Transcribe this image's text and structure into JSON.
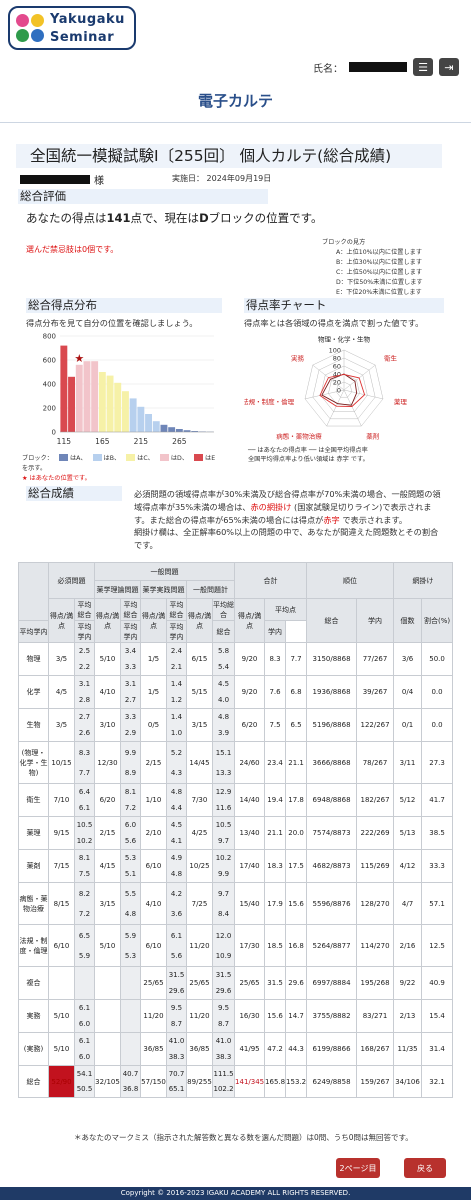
{
  "header": {
    "logo_line1": "Yakugaku",
    "logo_line2": "Seminar",
    "user_label": "氏名：",
    "list_icon": "list-icon",
    "logout_icon": "logout-icon",
    "page_title": "電子カルテ"
  },
  "exam": {
    "title": "全国統一模擬試験Ⅰ〔255回〕 個人カルテ(総合成績)",
    "name_suffix": "様",
    "date": "実施日： 2024年09月19日"
  },
  "evaluation": {
    "heading": "総合評価",
    "line_a": "あなたの得点は",
    "score": "141",
    "line_b": "点で、現在は",
    "block": "D",
    "line_c": "ブロックの位置です。",
    "forbidden": "選んだ禁忌肢は0個です。",
    "block_guide_title": "ブロックの見方",
    "block_guide": [
      "A：上位10%以内に位置します",
      "B：上位30%以内に位置します",
      "C：上位50%以内に位置します",
      "D：下位50%未満に位置します",
      "E：下位20%未満に位置します"
    ]
  },
  "distribution": {
    "heading": "総合得点分布",
    "sub": "得点分布を見て自分の位置を確認しましょう。",
    "legend_prefix": "ブロック：",
    "legend_items": [
      "はA、",
      "はB、",
      "はC、",
      "はD、",
      "はE"
    ],
    "legend_suffix": "を示す。",
    "star_note": "★ はあなたの位置です。"
  },
  "radar": {
    "heading": "得点率チャート",
    "sub": "得点率とは各領域の得点を満点で割った値です。",
    "legend_1": "── はあなたの得点率  ── は全国平均得点率",
    "legend_2": "全国平均得点率より低い領域は 赤字 です。"
  },
  "results": {
    "heading": "総合成績",
    "note_1": "必須問題の領域得点率が30%未満及び総合得点率が70%未満の場合、一般問題の領域得点率が35%未満の場合は、",
    "note_red_1": "赤の網掛け",
    "note_2": " (国家試験足切りライン)で表示されます。また総合の得点率が65%未満の場合には得点が",
    "note_red_2": "赤字",
    "note_3": " で表示されます。",
    "note_4": "網掛け欄は、全正解率60%以上の問題の中で、あなたが間違えた問題数とその割合です。"
  },
  "table": {
    "h_required": "必須問題",
    "h_general": "一般問題",
    "h_theory": "薬学理論問題",
    "h_practice": "薬学実践問題",
    "h_gen_total": "一般問題計",
    "h_total": "合計",
    "h_rank": "順位",
    "h_net": "網掛け",
    "h_score": "得点/満点",
    "h_avg_total": "平均総合",
    "h_avg_school": "平均学内",
    "h_avg": "平均点",
    "h_sogo": "総合",
    "h_gakunai": "学内",
    "h_count": "個数",
    "h_ratio": "割合(%)",
    "rows": [
      {
        "name": "物理",
        "req": "3/5",
        "req_a": "2.5",
        "req_b": "2.2",
        "th": "5/10",
        "th_a": "3.4",
        "th_b": "3.3",
        "pr": "1/5",
        "pr_a": "2.4",
        "pr_b": "2.1",
        "gt": "6/15",
        "gt_a": "5.8",
        "gt_b": "5.4",
        "tot": "9/20",
        "avg_t": "8.3",
        "avg_s": "7.7",
        "rank_t": "3150/8868",
        "rank_s": "77/267",
        "n": "3/6",
        "r": "50.0"
      },
      {
        "name": "化学",
        "req": "4/5",
        "req_a": "3.1",
        "req_b": "2.8",
        "th": "4/10",
        "th_a": "3.1",
        "th_b": "2.7",
        "pr": "1/5",
        "pr_a": "1.4",
        "pr_b": "1.2",
        "gt": "5/15",
        "gt_a": "4.5",
        "gt_b": "4.0",
        "tot": "9/20",
        "avg_t": "7.6",
        "avg_s": "6.8",
        "rank_t": "1936/8868",
        "rank_s": "39/267",
        "n": "0/4",
        "r": "0.0"
      },
      {
        "name": "生物",
        "req": "3/5",
        "req_a": "2.7",
        "req_b": "2.6",
        "th": "3/10",
        "th_a": "3.3",
        "th_b": "2.9",
        "pr": "0/5",
        "pr_a": "1.4",
        "pr_b": "1.0",
        "gt": "3/15",
        "gt_a": "4.8",
        "gt_b": "3.9",
        "tot": "6/20",
        "avg_t": "7.5",
        "avg_s": "6.5",
        "rank_t": "5196/8868",
        "rank_s": "122/267",
        "n": "0/1",
        "r": "0.0"
      },
      {
        "name": "(物理・化学・生物)",
        "req": "10/15",
        "req_a": "8.3",
        "req_b": "7.7",
        "th": "12/30",
        "th_a": "9.9",
        "th_b": "8.9",
        "pr": "2/15",
        "pr_a": "5.2",
        "pr_b": "4.3",
        "gt": "14/45",
        "gt_a": "15.1",
        "gt_b": "13.3",
        "tot": "24/60",
        "avg_t": "23.4",
        "avg_s": "21.1",
        "rank_t": "3666/8868",
        "rank_s": "78/267",
        "n": "3/11",
        "r": "27.3"
      },
      {
        "name": "衛生",
        "req": "7/10",
        "req_a": "6.4",
        "req_b": "6.1",
        "th": "6/20",
        "th_a": "8.1",
        "th_b": "7.2",
        "pr": "1/10",
        "pr_a": "4.8",
        "pr_b": "4.4",
        "gt": "7/30",
        "gt_a": "12.9",
        "gt_b": "11.6",
        "tot": "14/40",
        "avg_t": "19.4",
        "avg_s": "17.8",
        "rank_t": "6948/8868",
        "rank_s": "182/267",
        "n": "5/12",
        "r": "41.7"
      },
      {
        "name": "薬理",
        "req": "9/15",
        "req_a": "10.5",
        "req_b": "10.2",
        "th": "2/15",
        "th_a": "6.0",
        "th_b": "5.6",
        "pr": "2/10",
        "pr_a": "4.5",
        "pr_b": "4.1",
        "gt": "4/25",
        "gt_a": "10.5",
        "gt_b": "9.7",
        "tot": "13/40",
        "avg_t": "21.1",
        "avg_s": "20.0",
        "rank_t": "7574/8873",
        "rank_s": "222/269",
        "n": "5/13",
        "r": "38.5"
      },
      {
        "name": "薬剤",
        "req": "7/15",
        "req_a": "8.1",
        "req_b": "7.5",
        "th": "4/15",
        "th_a": "5.3",
        "th_b": "5.1",
        "pr": "6/10",
        "pr_a": "4.9",
        "pr_b": "4.8",
        "gt": "10/25",
        "gt_a": "10.2",
        "gt_b": "9.9",
        "tot": "17/40",
        "avg_t": "18.3",
        "avg_s": "17.5",
        "rank_t": "4682/8873",
        "rank_s": "115/269",
        "n": "4/12",
        "r": "33.3"
      },
      {
        "name": "病態・薬物治療",
        "req": "8/15",
        "req_a": "8.2",
        "req_b": "7.2",
        "th": "3/15",
        "th_a": "5.5",
        "th_b": "4.8",
        "pr": "4/10",
        "pr_a": "4.2",
        "pr_b": "3.6",
        "gt": "7/25",
        "gt_a": "9.7",
        "gt_b": "8.4",
        "tot": "15/40",
        "avg_t": "17.9",
        "avg_s": "15.6",
        "rank_t": "5596/8876",
        "rank_s": "128/270",
        "n": "4/7",
        "r": "57.1"
      },
      {
        "name": "法規・制度・倫理",
        "req": "6/10",
        "req_a": "6.5",
        "req_b": "5.9",
        "th": "5/10",
        "th_a": "5.9",
        "th_b": "5.3",
        "pr": "6/10",
        "pr_a": "6.1",
        "pr_b": "5.6",
        "gt": "11/20",
        "gt_a": "12.0",
        "gt_b": "10.9",
        "tot": "17/30",
        "avg_t": "18.5",
        "avg_s": "16.8",
        "rank_t": "5264/8877",
        "rank_s": "114/270",
        "n": "2/16",
        "r": "12.5"
      },
      {
        "name": "複合",
        "req": "",
        "req_a": "",
        "req_b": "",
        "th": "",
        "th_a": "",
        "th_b": "",
        "pr": "25/65",
        "pr_a": "31.5",
        "pr_b": "29.6",
        "gt": "25/65",
        "gt_a": "31.5",
        "gt_b": "29.6",
        "tot": "25/65",
        "avg_t": "31.5",
        "avg_s": "29.6",
        "rank_t": "6997/8884",
        "rank_s": "195/268",
        "n": "9/22",
        "r": "40.9"
      },
      {
        "name": "実務",
        "req": "5/10",
        "req_a": "6.1",
        "req_b": "6.0",
        "th": "",
        "th_a": "",
        "th_b": "",
        "pr": "11/20",
        "pr_a": "9.5",
        "pr_b": "8.7",
        "gt": "11/20",
        "gt_a": "9.5",
        "gt_b": "8.7",
        "tot": "16/30",
        "avg_t": "15.6",
        "avg_s": "14.7",
        "rank_t": "3755/8882",
        "rank_s": "83/271",
        "n": "2/13",
        "r": "15.4"
      },
      {
        "name": "(実務)",
        "req": "5/10",
        "req_a": "6.1",
        "req_b": "6.0",
        "th": "",
        "th_a": "",
        "th_b": "",
        "pr": "36/85",
        "pr_a": "41.0",
        "pr_b": "38.3",
        "gt": "36/85",
        "gt_a": "41.0",
        "gt_b": "38.3",
        "tot": "41/95",
        "avg_t": "47.2",
        "avg_s": "44.3",
        "rank_t": "6199/8866",
        "rank_s": "168/267",
        "n": "11/35",
        "r": "31.4"
      },
      {
        "name": "総合",
        "req": "52/90",
        "req_a": "54.1",
        "req_b": "50.5",
        "th": "32/105",
        "th_a": "40.7",
        "th_b": "36.8",
        "pr": "57/150",
        "pr_a": "70.7",
        "pr_b": "65.1",
        "gt": "89/255",
        "gt_a": "111.5",
        "gt_b": "102.2",
        "tot": "141/345",
        "avg_t": "165.8",
        "avg_s": "153.2",
        "rank_t": "6249/8858",
        "rank_s": "159/267",
        "n": "34/106",
        "r": "32.1"
      }
    ]
  },
  "footnote": "＊あなたのマークミス（指示された解答数と異なる数を選んだ問題）は0問、うち0問は無回答です。",
  "buttons": {
    "page2": "2ページ目",
    "back": "戻る"
  },
  "footer": "Copyright © 2016-2023 IGAKU ACADEMY ALL RIGHTS RESERVED.",
  "chart_data": [
    {
      "type": "bar",
      "title": "総合得点分布",
      "x_ticks": [
        115,
        165,
        215,
        265
      ],
      "y_ticks": [
        0,
        200,
        400,
        600,
        800
      ],
      "ylim": [
        0,
        800
      ],
      "values": [
        720,
        460,
        560,
        590,
        590,
        500,
        470,
        410,
        340,
        280,
        210,
        150,
        90,
        60,
        40,
        25,
        15,
        8,
        4,
        2
      ],
      "blocks": [
        "E",
        "E",
        "D",
        "D",
        "D",
        "C",
        "C",
        "C",
        "C",
        "B",
        "B",
        "B",
        "B",
        "A",
        "A",
        "A",
        "A",
        "A",
        "A",
        "A"
      ],
      "block_colors": {
        "A": "#6f86b8",
        "B": "#b7d0ee",
        "C": "#f6f1a7",
        "D": "#f2c4ca",
        "E": "#d9494f"
      },
      "your_position_index": 2,
      "star_label": "★"
    },
    {
      "type": "radar",
      "title": "得点率チャート",
      "axes": [
        "物理・化学・生物",
        "衛生",
        "薬理",
        "薬剤",
        "病態・薬物治療",
        "法規・制度・倫理",
        "実務"
      ],
      "r_ticks": [
        0,
        20,
        40,
        60,
        80,
        100
      ],
      "series": [
        {
          "name": "あなたの得点率",
          "values": [
            40,
            35,
            32.5,
            42.5,
            37.5,
            56.7,
            43.2
          ],
          "color": "#7a1b1b"
        },
        {
          "name": "全国平均得点率",
          "values": [
            39,
            48.5,
            52.8,
            45.8,
            44.8,
            61.7,
            49.7
          ],
          "color": "#d33"
        }
      ],
      "low_axes_color": "#c22"
    }
  ]
}
